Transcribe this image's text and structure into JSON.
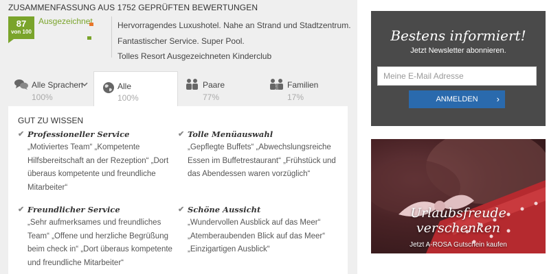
{
  "summary": {
    "title": "ZUSAMMENFASSUNG AUS 1752 GEPRÜFTEN BEWERTUNGEN",
    "score": "87",
    "score_of": "von 100",
    "rating_label": "Ausgezeichnet",
    "highlights": [
      "Hervorragendes Luxushotel. Nahe an Strand und Stadtzentrum.",
      "Fantastischer Service. Super Pool.",
      "Tolles Resort Ausgezeichneten Kinderclub"
    ]
  },
  "tabs": [
    {
      "label": "Alle Sprachen",
      "pct": "100%",
      "icon": "speech-bubbles-icon"
    },
    {
      "label": "Alle",
      "pct": "100%",
      "icon": "globe-icon"
    },
    {
      "label": "Paare",
      "pct": "77%",
      "icon": "couple-icon"
    },
    {
      "label": "Familien",
      "pct": "17%",
      "icon": "family-icon"
    }
  ],
  "good_to_know": {
    "title": "GUT ZU WISSEN",
    "items": [
      {
        "heading": "Professioneller Service",
        "quotes": "„Motiviertes Team“ „Kompetente Hilfsbereitschaft an der Rezeption“ „Dort überaus kompetente und freundliche Mitarbeiter“"
      },
      {
        "heading": "Tolle Menüauswahl",
        "quotes": "„Gepflegte Buffets“ „Abwechslungsreiche Essen im Buffetrestaurant“ „Frühstück und das Abendessen waren vorzüglich“"
      },
      {
        "heading": "Freundlicher Service",
        "quotes": "„Sehr aufmerksames und freundliches Team“ „Offene und herzliche Begrüßung beim check in“ „Dort überaus kompetente und freundliche Mitarbeiter“"
      },
      {
        "heading": "Schöne Aussicht",
        "quotes": "„Wundervollen Ausblick auf das Meer“ „Atemberaubenden Blick auf das Meer“ „Einzigartigen Ausblick“"
      }
    ]
  },
  "newsletter": {
    "title": "Bestens informiert!",
    "subtitle": "Jetzt Newsletter abonnieren.",
    "email_placeholder": "Meine E-Mail Adresse",
    "button_label": "ANMELDEN",
    "button_arrow": "›"
  },
  "gift": {
    "title_line1": "Urlaubsfreude",
    "title_line2": "verschenken",
    "subtitle": "Jetzt A-ROSA Gutschein kaufen"
  },
  "colors": {
    "score_green": "#7aa42b",
    "accent_orange": "#e8762b",
    "button_blue": "#2a6aad",
    "newsletter_bg": "#4a4a4a"
  }
}
